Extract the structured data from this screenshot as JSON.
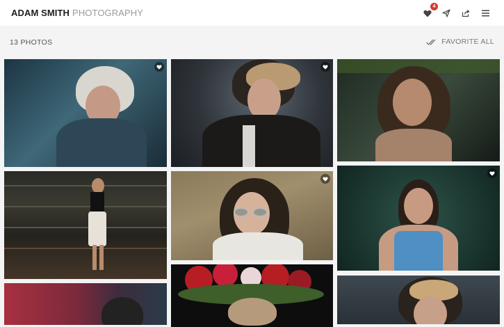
{
  "header": {
    "brand_bold": "ADAM SMITH",
    "brand_light": "PHOTOGRAPHY",
    "favorites_badge": "4",
    "icons": [
      "heart-icon",
      "send-icon",
      "share-icon",
      "menu-icon"
    ]
  },
  "toolbar": {
    "photo_count": "13 PHOTOS",
    "favorite_all_label": "FAVORITE ALL",
    "favorite_all_icon": "double-check-icon"
  },
  "colors": {
    "accent_badge": "#d63b2f",
    "background": "#f4f4f4",
    "header_bg": "#ffffff"
  },
  "gallery": {
    "photos": [
      {
        "subject": "woman-fur-hood-forest"
      },
      {
        "subject": "woman-dark-jacket-studio"
      },
      {
        "subject": "woman-leaf-shadows"
      },
      {
        "subject": "woman-stadium-seats"
      },
      {
        "subject": "woman-aviator-sunglasses"
      },
      {
        "subject": "woman-lying-in-leaves"
      },
      {
        "subject": "woman-red-interior"
      },
      {
        "subject": "woman-flower-crown"
      },
      {
        "subject": "woman-blonde-portrait"
      }
    ]
  }
}
